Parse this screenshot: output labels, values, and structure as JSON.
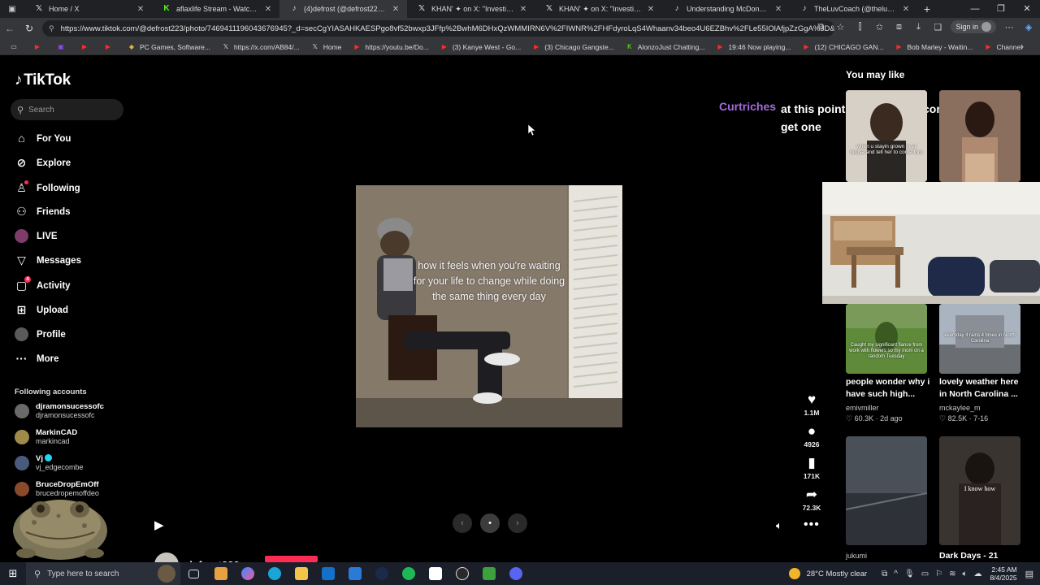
{
  "tabs": [
    {
      "label": "Home / X",
      "icon": "x-logo-icon",
      "active": false
    },
    {
      "label": "aflaxlife Stream - Watch Live on Kick",
      "icon": "kick-logo-icon",
      "active": false
    },
    {
      "label": "(4)defrost (@defrost223)'s video",
      "icon": "tiktok-logo-icon",
      "active": true
    },
    {
      "label": "KHAN' ✦ on X: \"Investing in wo",
      "icon": "x-logo-icon",
      "active": false
    },
    {
      "label": "KHAN' ✦ on X: \"Investing in wo",
      "icon": "x-logo-icon",
      "active": false
    },
    {
      "label": "Understanding McDonald's Men",
      "icon": "tiktok-logo-icon",
      "active": false
    },
    {
      "label": "TheLuvCoach (@theluvcoach) | T",
      "icon": "tiktok-logo-icon",
      "active": false
    }
  ],
  "address": {
    "url": "https://www.tiktok.com/@defrost223/photo/7469411196043676945?_d=secCgYIASAHKAESPgo8vf52bwxp3JFfp%2BwhM6DHxQzWMMIRN6V%2FIWNR%2FHFdyroLqS4Whaanv34beo4U6EZBhv%2FLe55IOlAfjpZzGgA%3D&_r=1&_..."
  },
  "signin_label": "Sign in",
  "bookmarks": [
    {
      "label": "",
      "icon": "youtube-icon"
    },
    {
      "label": "",
      "icon": "twitch-icon"
    },
    {
      "label": "",
      "icon": "youtube-icon"
    },
    {
      "label": "",
      "icon": "youtube-icon"
    },
    {
      "label": "PC Games, Software...",
      "icon": "game-icon"
    },
    {
      "label": "https://x.com/AB84/...",
      "icon": "x-logo-icon"
    },
    {
      "label": "Home",
      "icon": "x-logo-icon"
    },
    {
      "label": "https://youtu.be/Do...",
      "icon": "youtube-icon"
    },
    {
      "label": "(3) Kanye West - Go...",
      "icon": "youtube-icon"
    },
    {
      "label": "(3) Chicago Gangste...",
      "icon": "youtube-icon"
    },
    {
      "label": "AlonzoJust Chatting...",
      "icon": "kick-logo-icon"
    },
    {
      "label": "19:46 Now playing...",
      "icon": "youtube-icon"
    },
    {
      "label": "(12) CHICAGO GAN...",
      "icon": "youtube-icon"
    },
    {
      "label": "Bob Marley - Waitin...",
      "icon": "youtube-icon"
    },
    {
      "label": "Channel",
      "icon": "youtube-icon"
    }
  ],
  "brand": {
    "name": "TikTok"
  },
  "search": {
    "placeholder": "Search"
  },
  "nav": [
    {
      "label": "For You",
      "icon": "home-icon"
    },
    {
      "label": "Explore",
      "icon": "compass-icon"
    },
    {
      "label": "Following",
      "icon": "user-follow-icon"
    },
    {
      "label": "Friends",
      "icon": "friends-icon"
    },
    {
      "label": "LIVE",
      "icon": "live-icon"
    },
    {
      "label": "Messages",
      "icon": "paper-plane-icon"
    },
    {
      "label": "Activity",
      "icon": "activity-icon",
      "badge": "4"
    },
    {
      "label": "Upload",
      "icon": "upload-icon"
    },
    {
      "label": "Profile",
      "icon": "profile-icon"
    },
    {
      "label": "More",
      "icon": "more-icon"
    }
  ],
  "following_accounts": {
    "title": "Following accounts",
    "items": [
      {
        "name": "djramonsucessofc",
        "user": "djramonsucessofc",
        "color": "#6a6a6a"
      },
      {
        "name": "MarkinCAD",
        "user": "markincad",
        "color": "#a08a4a"
      },
      {
        "name": "Vj",
        "user": "vj_edgecombe",
        "color": "#4a5a7a",
        "verified": true
      },
      {
        "name": "BruceDropEmOff",
        "user": "brucedropemoffdeo",
        "color": "#8a4a2a"
      }
    ]
  },
  "post": {
    "caption_user": "Curtriches",
    "caption_text": "at this point just go to the corner store n get one",
    "photo_text": "how it feels when you're waiting for your life to change while doing the same thing every day",
    "likes": "1.1M",
    "comments": "4926",
    "saves": "171K",
    "shares": "72.3K",
    "author": "defrost223"
  },
  "you_may_like": {
    "title": "You may like",
    "items": [
      {
        "caption": "",
        "user": "",
        "stat": "",
        "thumb_text": "when u stayin grown in ur house and tell her to come thru"
      },
      {
        "caption": "",
        "user": "",
        "stat": "",
        "thumb_text": ""
      },
      {
        "caption": "people wonder why i have such high...",
        "user": "emivmiller",
        "stat": "60.3K · 2d ago",
        "thumb_text": "Caught my significant fiance from work with flowers so my mom on a random Tuesday"
      },
      {
        "caption": "lovely weather here in North Carolina ...",
        "user": "mckaylee_m",
        "stat": "82.5K · 7-16",
        "thumb_text": "everyday it rains 4 times in North Carolina"
      },
      {
        "caption": "",
        "user": "jukumi",
        "stat": "",
        "thumb_text": ""
      },
      {
        "caption": "Dark Days - 21",
        "user": "",
        "stat": "",
        "thumb_text": "I know how"
      }
    ]
  },
  "taskbar": {
    "search_placeholder": "Type here to search",
    "weather": "28°C  Mostly clear",
    "time": "2:45 AM",
    "date": "8/4/2025"
  },
  "colors": {
    "accent_pink": "#fe2c55",
    "caption_user": "#a06bd9",
    "verified": "#20d5ec"
  }
}
